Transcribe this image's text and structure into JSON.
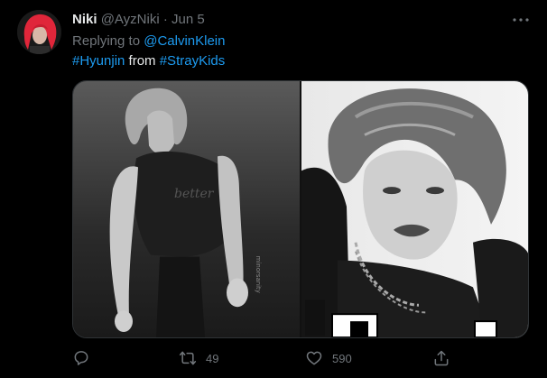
{
  "tweet": {
    "author_name": "Niki",
    "author_handle": "@AyzNiki",
    "separator": "·",
    "date": "Jun 5",
    "more_icon": "more-dots-icon",
    "replying_label": "Replying to",
    "replying_to": "@CalvinKlein",
    "hashtag_1": "#Hyunjin",
    "text_between": "from",
    "hashtag_2": "#StrayKids"
  },
  "media": {
    "photos": [
      "left-photo",
      "right-photo"
    ],
    "watermark": "minorsanity"
  },
  "actions": {
    "reply": {
      "icon": "reply-icon",
      "count": ""
    },
    "retweet": {
      "icon": "retweet-icon",
      "count": "49"
    },
    "like": {
      "icon": "heart-icon",
      "count": "590"
    },
    "share": {
      "icon": "share-icon",
      "count": ""
    }
  },
  "colors": {
    "background": "#000000",
    "text_primary": "#e7e9ea",
    "text_secondary": "#71767b",
    "link": "#1d9bf0",
    "avatar_hair": "#e0263a"
  }
}
